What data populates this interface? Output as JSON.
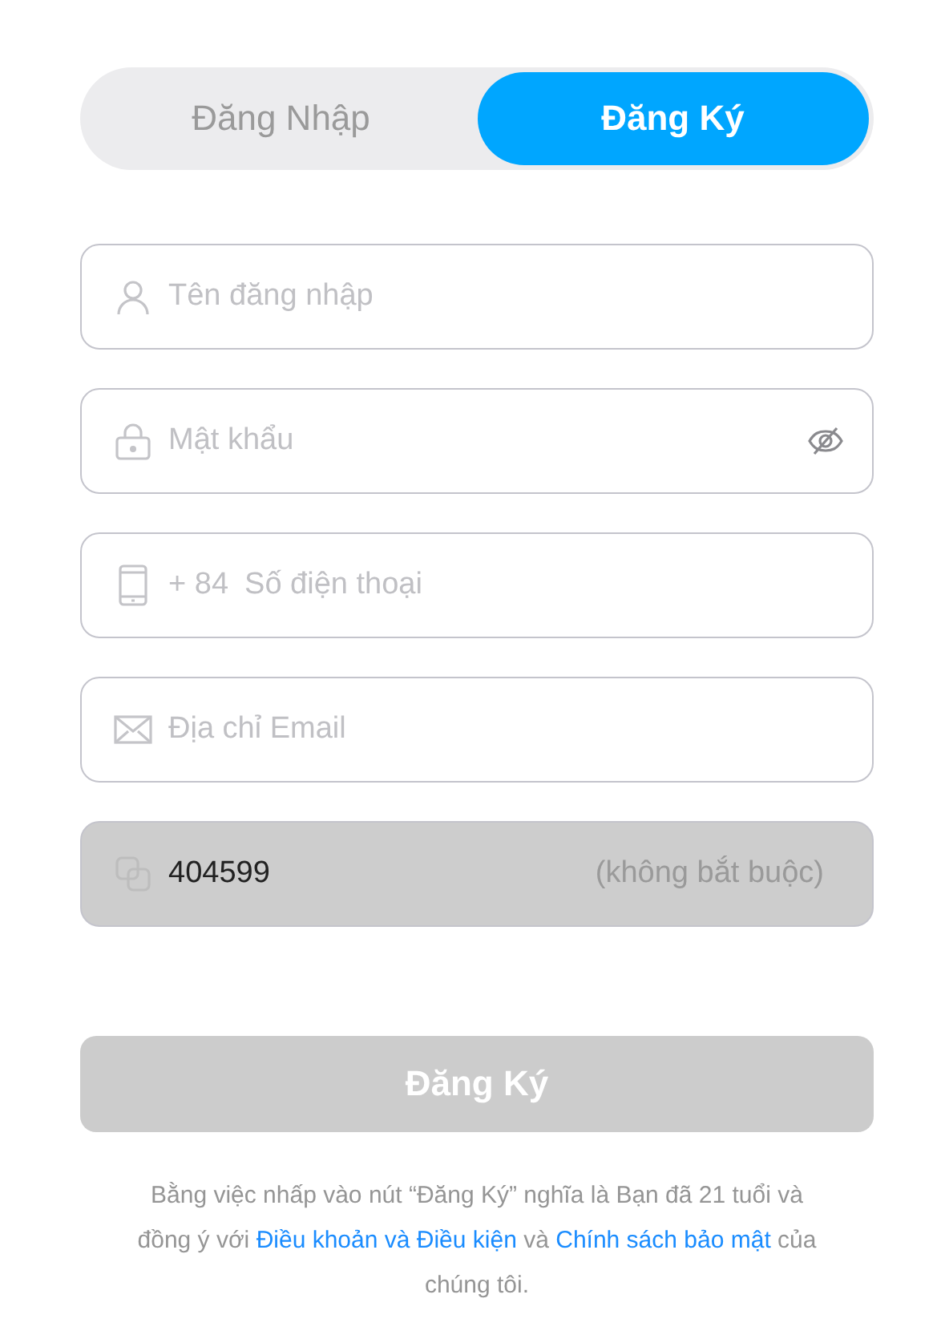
{
  "tabs": [
    {
      "label": "Đăng Nhập",
      "selected": false
    },
    {
      "label": "Đăng Ký",
      "selected": true
    }
  ],
  "fields": [
    {
      "kind": "user",
      "placeholder": "Tên đăng nhập",
      "disabled": false
    },
    {
      "kind": "password",
      "placeholder": "Mật khẩu",
      "disabled": false
    },
    {
      "kind": "phone",
      "prefix": "+ 84",
      "placeholder": "Số điện thoại",
      "disabled": false
    },
    {
      "kind": "email",
      "placeholder": "Địa chỉ Email",
      "disabled": false
    },
    {
      "kind": "code",
      "value": "404599",
      "hint": "(không bắt buộc)",
      "disabled": true
    }
  ],
  "submit": {
    "label": "Đăng Ký",
    "disabled": true
  },
  "legal": [
    {
      "kind": "text",
      "text": "Bằng việc nhấp vào nút “Đăng Ký” nghĩa là Bạn đã 21 tuổi và đồng ý với "
    },
    {
      "kind": "link",
      "text": "Điều khoản và Điều kiện"
    },
    {
      "kind": "text",
      "text": " và "
    },
    {
      "kind": "link",
      "text": "Chính sách bảo mật"
    },
    {
      "kind": "text",
      "text": " của chúng tôi."
    }
  ]
}
